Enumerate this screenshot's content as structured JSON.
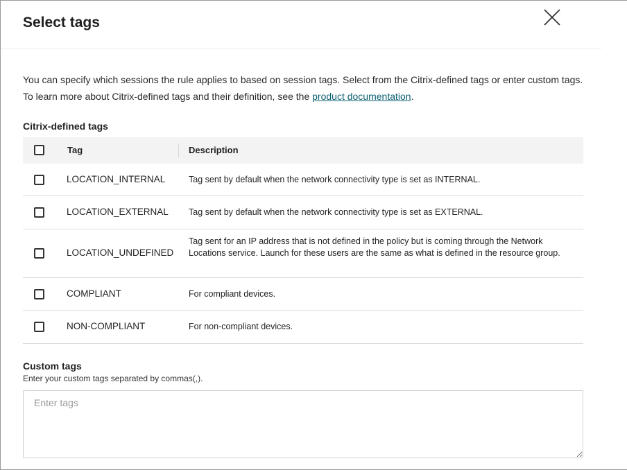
{
  "dialog": {
    "title": "Select tags",
    "close_icon": "close-icon"
  },
  "intro": {
    "text_before_link": "You can specify which sessions the rule applies to based on session tags. Select from the Citrix-defined tags or enter custom tags. To learn more about Citrix-defined tags and their definition, see the ",
    "link_text": "product documentation",
    "text_after_link": "."
  },
  "citrix_tags": {
    "section_label": "Citrix-defined tags",
    "headers": {
      "tag": "Tag",
      "description": "Description"
    },
    "rows": [
      {
        "tag": "LOCATION_INTERNAL",
        "description": "Tag sent by default when the network connectivity type is set as INTERNAL."
      },
      {
        "tag": "LOCATION_EXTERNAL",
        "description": "Tag sent by default when the network connectivity type is set as EXTERNAL."
      },
      {
        "tag": "LOCATION_UNDEFINED",
        "description": "Tag sent for an IP address that is not defined in the policy but is coming through the Network Locations service. Launch for these users are the same as what is defined in the resource group."
      },
      {
        "tag": "COMPLIANT",
        "description": "For compliant devices."
      },
      {
        "tag": "NON-COMPLIANT",
        "description": "For non-compliant devices."
      }
    ]
  },
  "custom_tags": {
    "label": "Custom tags",
    "help": "Enter your custom tags separated by commas(,).",
    "placeholder": "Enter tags",
    "value": ""
  },
  "colors": {
    "link": "#0b5f73",
    "header_bg": "#f3f3f3",
    "border": "#dcdcdc"
  }
}
